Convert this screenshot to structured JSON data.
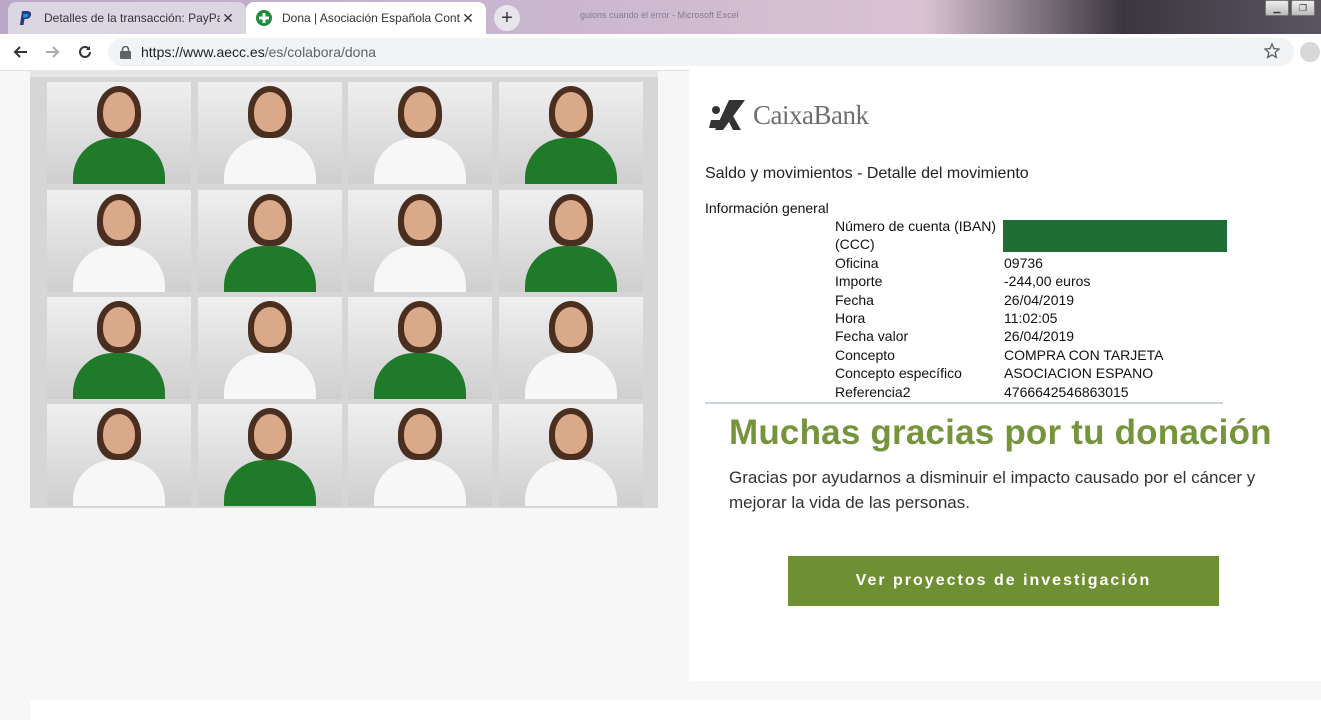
{
  "browser": {
    "tabs": [
      {
        "title": "Detalles de la transacción: PayPal",
        "favicon": "paypal-icon",
        "active": false
      },
      {
        "title": "Dona | Asociación Española Cont",
        "favicon": "aecc-icon",
        "active": true
      }
    ],
    "background_window_text": "guions cuando el error - Microsoft Excel",
    "url_host": "https://www.aecc.es",
    "url_path": "/es/colabora/dona"
  },
  "page": {
    "photo_grid": {
      "rows": [
        [
          "green",
          "white",
          "white",
          "green"
        ],
        [
          "white",
          "green",
          "white",
          "green"
        ],
        [
          "green",
          "white",
          "green",
          "white"
        ],
        [
          "white",
          "green",
          "white",
          "white"
        ]
      ]
    },
    "receipt": {
      "bank_name": "CaixaBank",
      "title": "Saldo y movimientos - Detalle del movimiento",
      "section": "Información general",
      "account_label": "Número de cuenta (IBAN)",
      "account_label_2": "(CCC)",
      "account_value": "",
      "rows": [
        {
          "label": "Oficina",
          "value": "09736"
        },
        {
          "label": "Importe",
          "value": "-244,00 euros"
        },
        {
          "label": "Fecha",
          "value": "26/04/2019"
        },
        {
          "label": "Hora",
          "value": "11:02:05"
        },
        {
          "label": "Fecha valor",
          "value": "26/04/2019"
        },
        {
          "label": "Concepto",
          "value": "COMPRA CON TARJETA"
        },
        {
          "label": "Concepto específico",
          "value": "ASOCIACION ESPANO"
        },
        {
          "label": "Referencia2",
          "value": "4766642546863015"
        }
      ]
    },
    "thanks_heading": "Muchas gracias por tu donación",
    "thanks_body": "Gracias por ayudarnos a disminuir el impacto causado por el cáncer y mejorar la vida de las personas.",
    "cta_label": "Ver proyectos de investigación"
  },
  "colors": {
    "brand_green": "#76943c",
    "button_green": "#6f8f33",
    "redaction_green": "#1e6e35"
  }
}
